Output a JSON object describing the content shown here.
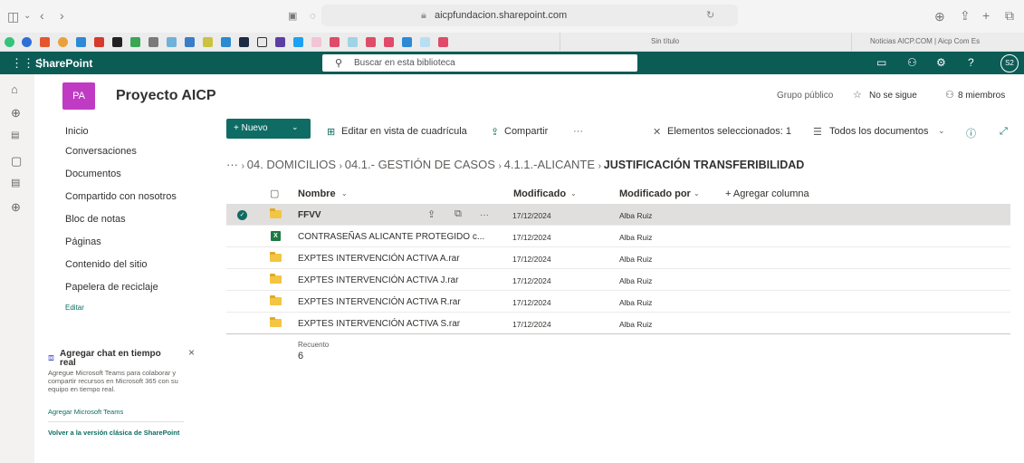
{
  "browser": {
    "url": "aicpfundacion.sharepoint.com",
    "left_tab": "Sin título",
    "right_tab": "Noticias AICP.COM | Aicp Com Es"
  },
  "suite": {
    "app_name": "SharePoint",
    "search_placeholder": "Buscar en esta biblioteca",
    "avatar": "S2",
    "color": "#0c5c56"
  },
  "site": {
    "initials": "PA",
    "title": "Proyecto AICP",
    "group_type": "Grupo público",
    "follow": "No se sigue",
    "members": "8 miembros",
    "logo_color": "#c03bc4"
  },
  "nav": {
    "items": [
      "Inicio",
      "Conversaciones",
      "Documentos",
      "Compartido con nosotros",
      "Bloc de notas",
      "Páginas",
      "Contenido del sitio",
      "Papelera de reciclaje"
    ],
    "edit": "Editar"
  },
  "teams": {
    "title": "Agregar chat en tiempo real",
    "desc": "Agregue Microsoft Teams para colaborar y compartir recursos en Microsoft 365 con su equipo en tiempo real.",
    "link": "Agregar Microsoft Teams"
  },
  "classic": "Volver a la versión clásica de SharePoint",
  "commands": {
    "new": "+ Nuevo",
    "grid": "Editar en vista de cuadrícula",
    "share": "Compartir",
    "more": "···",
    "selected": "Elementos seleccionados: 1",
    "view": "Todos los documentos"
  },
  "breadcrumb": {
    "ellipsis": "···",
    "items": [
      "04. DOMICILIOS",
      "04.1.- GESTIÓN DE CASOS",
      "4.1.1.-ALICANTE"
    ],
    "current": "JUSTIFICACIÓN TRANSFERIBILIDAD"
  },
  "columns": {
    "name": "Nombre",
    "modified": "Modificado",
    "modified_by": "Modificado por",
    "add": "+ Agregar columna"
  },
  "rows": [
    {
      "name": "FFVV",
      "date": "17/12/2024",
      "by": "Alba Ruiz",
      "type": "folder",
      "selected": true
    },
    {
      "name": "CONTRASEÑAS ALICANTE PROTEGIDO c...",
      "date": "17/12/2024",
      "by": "Alba Ruiz",
      "type": "excel"
    },
    {
      "name": "EXPTES INTERVENCIÓN ACTIVA A.rar",
      "date": "17/12/2024",
      "by": "Alba Ruiz",
      "type": "rar"
    },
    {
      "name": "EXPTES INTERVENCIÓN ACTIVA J.rar",
      "date": "17/12/2024",
      "by": "Alba Ruiz",
      "type": "rar"
    },
    {
      "name": "EXPTES INTERVENCIÓN ACTIVA R.rar",
      "date": "17/12/2024",
      "by": "Alba Ruiz",
      "type": "rar"
    },
    {
      "name": "EXPTES INTERVENCIÓN ACTIVA S.rar",
      "date": "17/12/2024",
      "by": "Alba Ruiz",
      "type": "rar"
    }
  ],
  "count": {
    "label": "Recuento",
    "value": "6"
  }
}
